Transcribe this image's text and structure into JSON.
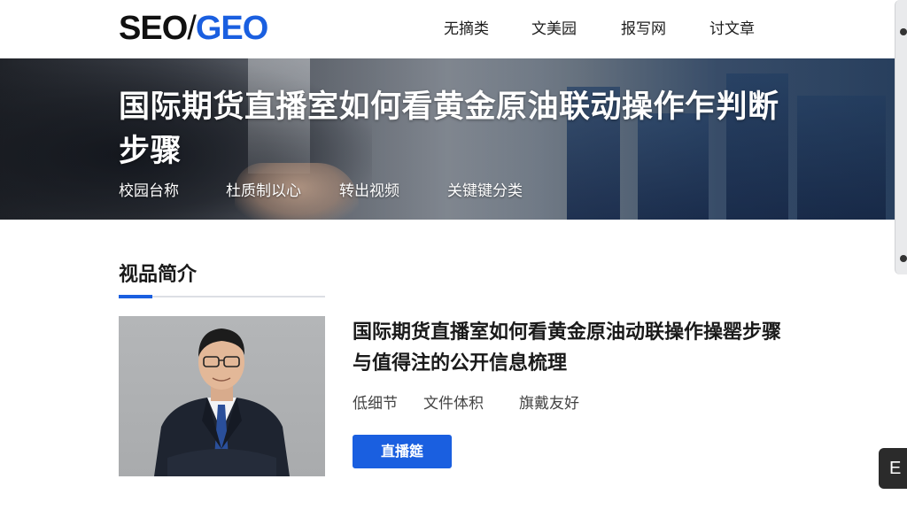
{
  "header": {
    "logo": {
      "part1": "SEO",
      "separator": "/",
      "part2": "GEO"
    },
    "nav": [
      {
        "label": "无摘类"
      },
      {
        "label": "文美园"
      },
      {
        "label": "报写网"
      },
      {
        "label": "讨文章"
      }
    ]
  },
  "hero": {
    "title": "国际期货直播室如何看黄金原油联动操作乍判断步骤",
    "tabs": [
      {
        "label": "校园台称"
      },
      {
        "label": "杜质制以心"
      },
      {
        "label": "转出视频"
      },
      {
        "label": "关键键分类"
      }
    ]
  },
  "section": {
    "title": "视品简介"
  },
  "card": {
    "title": "国际期货直播室如何看黄金原油动联操作操罂步骤与值得注的公开信息梳理",
    "meta": [
      {
        "label": "低细节"
      },
      {
        "label": "文件体积"
      },
      {
        "label": "旗戴友好"
      }
    ],
    "button": "直播筵"
  },
  "floating_button": {
    "label": "E"
  },
  "colors": {
    "accent": "#1a5fe0",
    "text": "#1a1a1a"
  }
}
